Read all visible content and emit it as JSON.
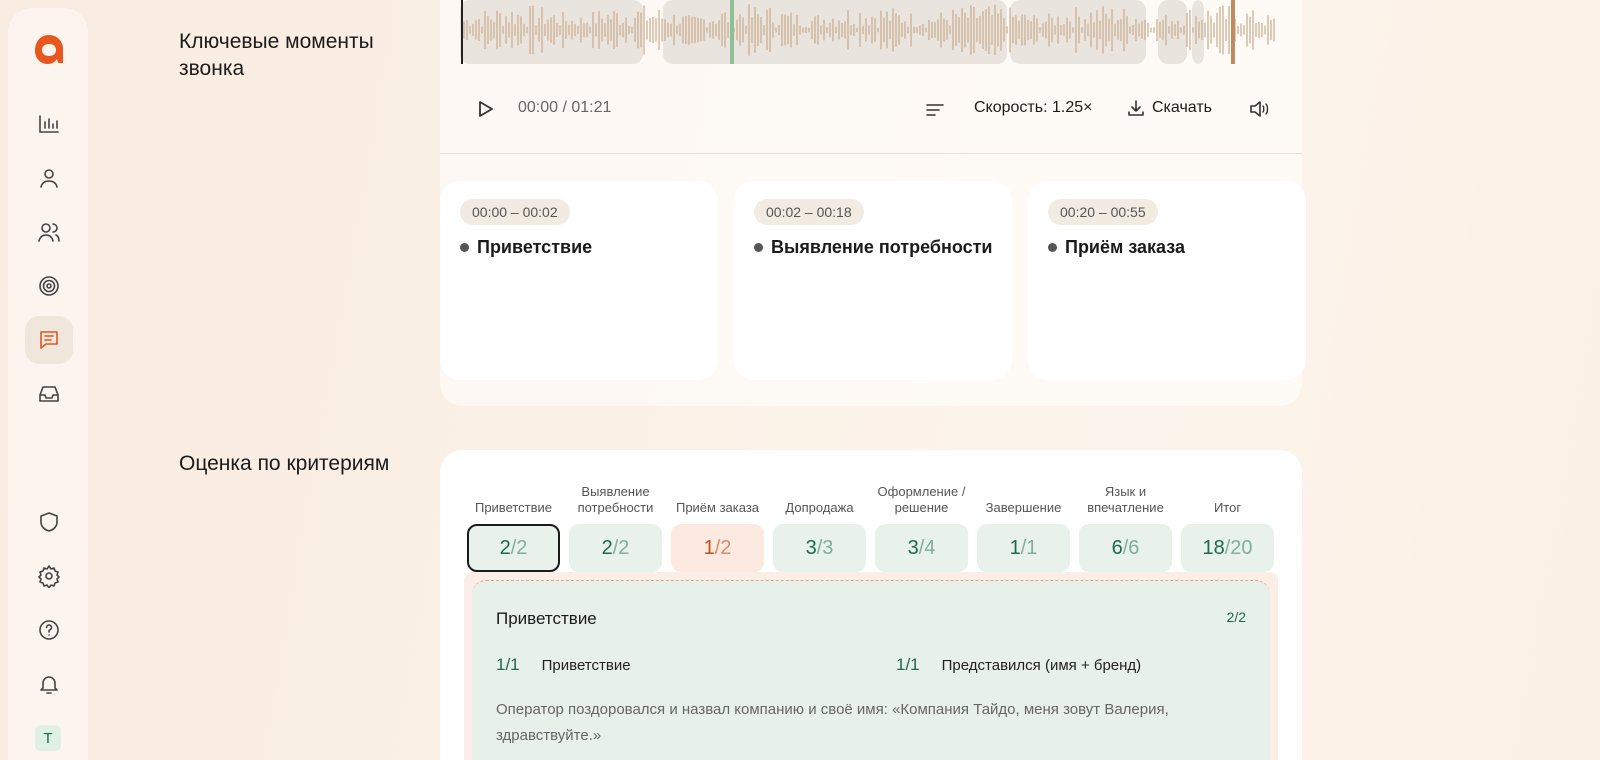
{
  "sidebar": {
    "logo": "brand-logo",
    "items": [
      {
        "name": "analytics",
        "icon": "bar-chart-icon"
      },
      {
        "name": "profile",
        "icon": "user-icon"
      },
      {
        "name": "team",
        "icon": "users-icon"
      },
      {
        "name": "goals",
        "icon": "target-icon"
      },
      {
        "name": "calls",
        "icon": "message-square-icon",
        "active": true
      },
      {
        "name": "inbox",
        "icon": "inbox-icon"
      }
    ],
    "bottom_items": [
      {
        "name": "security",
        "icon": "shield-icon"
      },
      {
        "name": "settings",
        "icon": "gear-icon"
      },
      {
        "name": "help",
        "icon": "help-circle-icon"
      },
      {
        "name": "notifications",
        "icon": "bell-icon"
      }
    ],
    "avatar_letter": "Т"
  },
  "key_moments": {
    "title": "Ключевые моменты звонка",
    "player": {
      "time": "00:00 / 01:21",
      "speed": "Скорость: 1.25×",
      "download": "Скачать"
    },
    "cards": [
      {
        "time": "00:00 – 00:02",
        "label": "Приветствие"
      },
      {
        "time": "00:02 – 00:18",
        "label": "Выявление потребности"
      },
      {
        "time": "00:20 – 00:55",
        "label": "Приём заказа"
      }
    ]
  },
  "criteria": {
    "title": "Оценка по критериям",
    "columns": [
      {
        "label": "Приветствие",
        "score": "2",
        "max": "2",
        "state": "selected"
      },
      {
        "label": "Выявление потребности",
        "score": "2",
        "max": "2",
        "state": "ok"
      },
      {
        "label": "Приём заказа",
        "score": "1",
        "max": "2",
        "state": "warn"
      },
      {
        "label": "Допродажа",
        "score": "3",
        "max": "3",
        "state": "ok"
      },
      {
        "label": "Оформление / решение",
        "score": "3",
        "max": "4",
        "state": "ok"
      },
      {
        "label": "Завершение",
        "score": "1",
        "max": "1",
        "state": "ok"
      },
      {
        "label": "Язык и впечатление",
        "score": "6",
        "max": "6",
        "state": "ok"
      },
      {
        "label": "Итог",
        "score": "18",
        "max": "20",
        "state": "ok"
      }
    ],
    "detail": {
      "title": "Приветствие",
      "score": "2/2",
      "items": [
        {
          "score": "1/1",
          "label": "Приветствие"
        },
        {
          "score": "1/1",
          "label": "Представился (имя + бренд)"
        }
      ],
      "comment": "Оператор поздоровался и назвал компанию и своё имя: «Компания Тайдо,  меня зовут Валерия, здравствуйте.»"
    }
  },
  "colors": {
    "accent": "#e0571f",
    "good": "#1d6b4a",
    "warn": "#c94f1a"
  }
}
